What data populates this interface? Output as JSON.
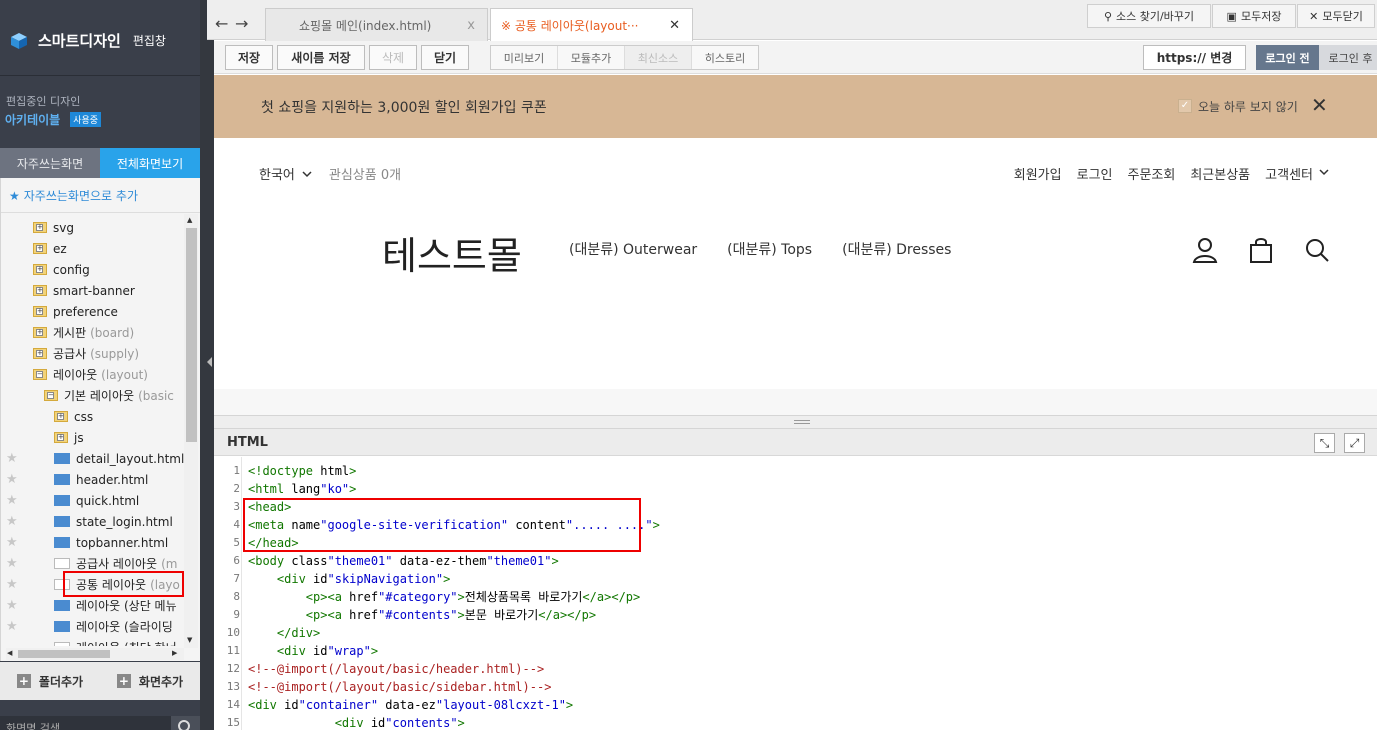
{
  "sidebar": {
    "app_title": "스마트디자인",
    "app_subtitle": "편집창",
    "editing_caption": "편집중인 디자인",
    "design_name": "아키테이블",
    "design_badge": "사용중",
    "tab_frequent": "자주쓰는화면",
    "tab_all": "전체화면보기",
    "add_favorite": "자주쓰는화면으로 추가",
    "tree": [
      {
        "type": "folder",
        "name": "svg",
        "sub": "",
        "indent": 1,
        "star": false
      },
      {
        "type": "folder",
        "name": "ez",
        "sub": "",
        "indent": 1,
        "star": false
      },
      {
        "type": "folder",
        "name": "config",
        "sub": "",
        "indent": 1,
        "star": false
      },
      {
        "type": "folder",
        "name": "smart-banner",
        "sub": "",
        "indent": 1,
        "star": false
      },
      {
        "type": "folder",
        "name": "preference",
        "sub": "",
        "indent": 1,
        "star": false
      },
      {
        "type": "folder",
        "name": "게시판",
        "sub": "(board)",
        "indent": 1,
        "star": false
      },
      {
        "type": "folder",
        "name": "공급사",
        "sub": "(supply)",
        "indent": 1,
        "star": false
      },
      {
        "type": "folder-open",
        "name": "레이아웃",
        "sub": "(layout)",
        "indent": 1,
        "star": false
      },
      {
        "type": "folder-open",
        "name": "기본 레이아웃",
        "sub": "(basic",
        "indent": 2,
        "star": false
      },
      {
        "type": "folder",
        "name": "css",
        "sub": "",
        "indent": 3,
        "star": false
      },
      {
        "type": "folder",
        "name": "js",
        "sub": "",
        "indent": 3,
        "star": false
      },
      {
        "type": "file",
        "name": "detail_layout.html",
        "sub": "",
        "indent": 3,
        "star": true
      },
      {
        "type": "file",
        "name": "header.html",
        "sub": "",
        "indent": 3,
        "star": true
      },
      {
        "type": "file",
        "name": "quick.html",
        "sub": "",
        "indent": 3,
        "star": true
      },
      {
        "type": "file",
        "name": "state_login.html",
        "sub": "",
        "indent": 3,
        "star": true
      },
      {
        "type": "file",
        "name": "topbanner.html",
        "sub": "",
        "indent": 3,
        "star": true
      },
      {
        "type": "file-blank",
        "name": "공급사 레이아웃",
        "sub": "(m",
        "indent": 3,
        "star": true
      },
      {
        "type": "file-blank",
        "name": "공통 레이아웃",
        "sub": "(layo",
        "indent": 3,
        "star": true
      },
      {
        "type": "file",
        "name": "레이아웃 (상단 메뉴",
        "sub": "",
        "indent": 3,
        "star": true
      },
      {
        "type": "file",
        "name": "레이아웃 (슬라이딩",
        "sub": "",
        "indent": 3,
        "star": true
      },
      {
        "type": "file-blank",
        "name": "레이아웃 (최단 한너",
        "sub": "",
        "indent": 3,
        "star": false
      }
    ],
    "btn_add_folder": "폴더추가",
    "btn_add_screen": "화면추가",
    "search_placeholder": "화면명 검색"
  },
  "topbar": {
    "tab1_label": "쇼핑몰 메인(index.html)",
    "tab2_label": "※ 공통 레이아웃(layout···",
    "find_replace": "소스 찾기/바꾸기",
    "save_all": "모두저장",
    "close_all": "모두닫기"
  },
  "toolbar": {
    "save": "저장",
    "save_as": "새이름 저장",
    "delete": "삭제",
    "close": "닫기",
    "preview": "미리보기",
    "add_module": "모듈추가",
    "latest_source": "최신소스",
    "history": "히스토리",
    "https_change": "https:// 변경",
    "before_login": "로그인 전",
    "after_login": "로그인 후"
  },
  "preview": {
    "banner_text": "첫 쇼핑을 지원하는 3,000원 할인 회원가입 쿠폰",
    "banner_dismiss": "오늘 하루 보지 않기",
    "language": "한국어",
    "wishlist": "관심상품 0개",
    "util_links": [
      "회원가입",
      "로그인",
      "주문조회",
      "최근본상품",
      "고객센터"
    ],
    "logo": "테스트몰",
    "categories": [
      "(대분류) Outerwear",
      "(대분류) Tops",
      "(대분류) Dresses"
    ]
  },
  "editor": {
    "label": "HTML",
    "lines": [
      {
        "n": "1",
        "t": "<!doctype html>"
      },
      {
        "n": "2",
        "t": "<html lang=\"ko\">"
      },
      {
        "n": "3",
        "t": "<head>"
      },
      {
        "n": "4",
        "t": "<meta name=\"google-site-verification\" content=\"..... ....\">"
      },
      {
        "n": "5",
        "t": "</head>"
      },
      {
        "n": "6",
        "t": "<body class=\"theme01\" data-ez-them=\"theme01\">"
      },
      {
        "n": "7",
        "t": "    <div id=\"skipNavigation\">"
      },
      {
        "n": "8",
        "t": "        <p><a href=\"#category\">전체상품목록 바로가기</a></p>"
      },
      {
        "n": "9",
        "t": "        <p><a href=\"#contents\">본문 바로가기</a></p>"
      },
      {
        "n": "10",
        "t": "    </div>"
      },
      {
        "n": "11",
        "t": "    <div id=\"wrap\">"
      },
      {
        "n": "12",
        "t": "<!--@import(/layout/basic/header.html)-->"
      },
      {
        "n": "13",
        "t": "<!--@import(/layout/basic/sidebar.html)-->"
      },
      {
        "n": "14",
        "t": "<div id=\"container\" data-ez=\"layout-08lcxzt-1\">"
      },
      {
        "n": "15",
        "t": "            <div id=\"contents\">"
      }
    ]
  }
}
